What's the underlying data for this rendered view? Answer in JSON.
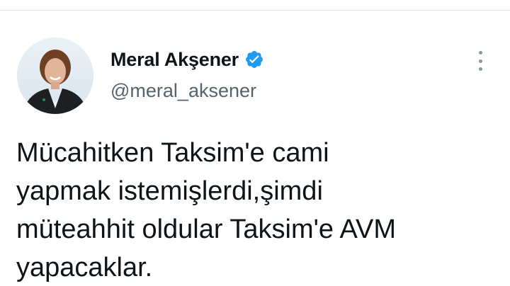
{
  "tweet": {
    "author": {
      "display_name": "Meral Akşener",
      "handle": "@meral_aksener",
      "verified": true
    },
    "text_lines": [
      "Mücahitken Taksim'e cami",
      "yapmak istemişlerdi,şimdi",
      "müteahhit oldular Taksim'e AVM",
      "yapacaklar."
    ]
  },
  "icons": {
    "verified": "verified-badge-icon",
    "more": "more-options-icon"
  },
  "colors": {
    "verified_blue": "#1d9bf0",
    "handle_gray": "#536471",
    "text": "#0f1419"
  }
}
